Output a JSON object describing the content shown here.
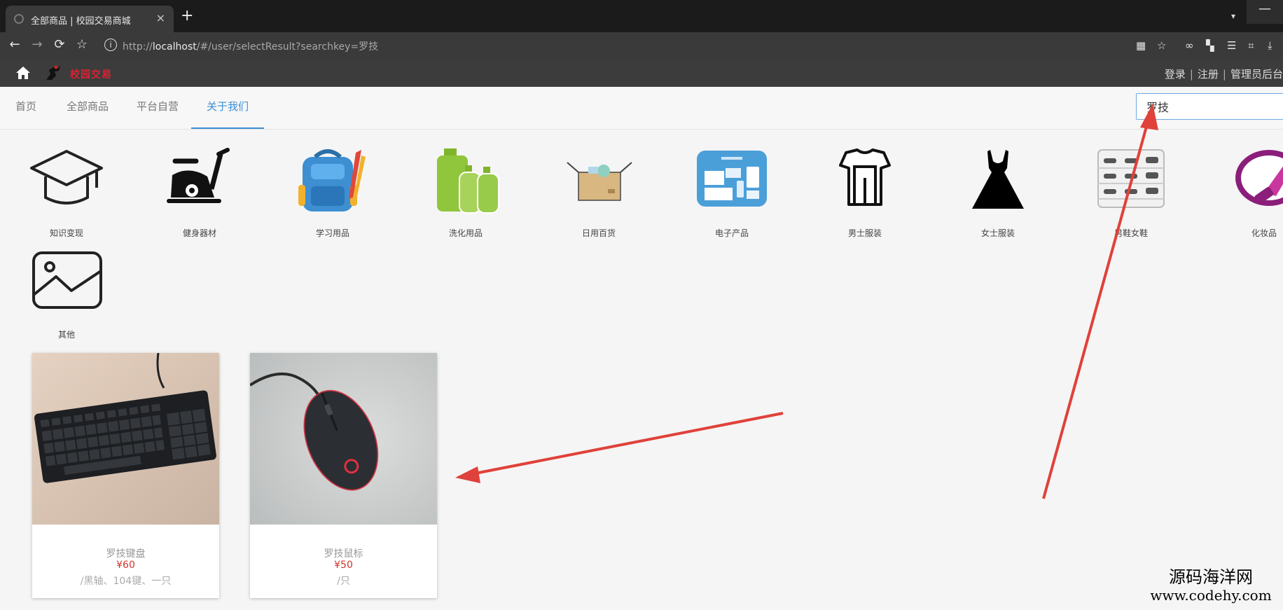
{
  "browser": {
    "tab_title": "全部商品 | 校园交易商城",
    "tab_close": "×",
    "new_tab": "+",
    "tab_menu": "▾",
    "window_min": "—",
    "url_host_prefix": "http://",
    "url_host": "localhost",
    "url_path": "/#/user/selectResult?searchkey=罗技"
  },
  "site": {
    "logo_text": "校园交易",
    "auth": {
      "login": "登录",
      "register": "注册",
      "admin": "管理员后台",
      "separator": "|"
    }
  },
  "nav": {
    "items": [
      {
        "label": "首页"
      },
      {
        "label": "全部商品"
      },
      {
        "label": "平台自营"
      },
      {
        "label": "关于我们"
      }
    ],
    "active_index": 3,
    "search_value": "罗技"
  },
  "categories": [
    {
      "label": "知识变现",
      "icon": "graduation-cap-icon"
    },
    {
      "label": "健身器材",
      "icon": "exercise-bike-icon"
    },
    {
      "label": "学习用品",
      "icon": "school-backpack-icon"
    },
    {
      "label": "洗化用品",
      "icon": "toiletries-bottles-icon"
    },
    {
      "label": "日用百货",
      "icon": "open-box-icon"
    },
    {
      "label": "电子产品",
      "icon": "electronics-devices-icon"
    },
    {
      "label": "男士服装",
      "icon": "mens-clothing-icon"
    },
    {
      "label": "女士服装",
      "icon": "dress-icon"
    },
    {
      "label": "男鞋女鞋",
      "icon": "shoe-rack-icon"
    },
    {
      "label": "化妆品",
      "icon": "lipstick-icon"
    },
    {
      "label": "其他",
      "icon": "image-placeholder-icon"
    }
  ],
  "products": [
    {
      "name": "罗技键盘",
      "price": "¥60",
      "unit": "/黑轴、104键、一只",
      "image": "keyboard-photo"
    },
    {
      "name": "罗技鼠标",
      "price": "¥50",
      "unit": "/只",
      "image": "mouse-photo"
    }
  ],
  "watermark": {
    "cn": "源码海洋网",
    "en": "www.codehy.com"
  },
  "colors": {
    "accent": "#3b8fd6",
    "price": "#d0342c",
    "annotation_arrow": "#e0413a",
    "header_bg": "#3c3c3c"
  }
}
